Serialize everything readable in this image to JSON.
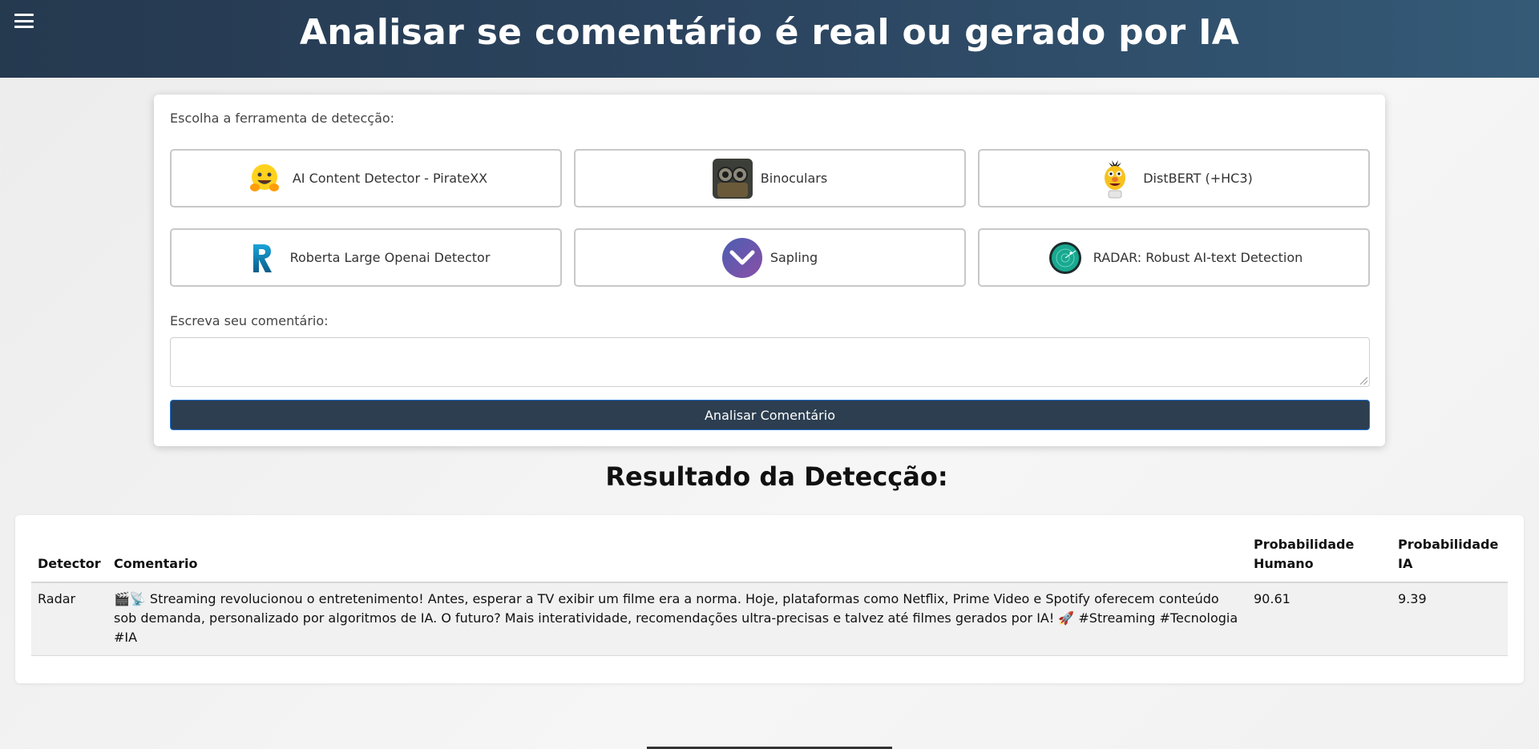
{
  "header": {
    "title": "Analisar se comentário é real ou gerado por IA",
    "menu_icon": "hamburger-menu-icon"
  },
  "form": {
    "tool_label": "Escolha a ferramenta de detecção:",
    "tools": [
      {
        "label": "AI Content Detector - PirateXX",
        "icon": "hugging-face-icon"
      },
      {
        "label": "Binoculars",
        "icon": "binoculars-robot-icon"
      },
      {
        "label": "DistBERT (+HC3)",
        "icon": "bert-muppet-icon"
      },
      {
        "label": "Roberta Large Openai Detector",
        "icon": "roberta-r-icon"
      },
      {
        "label": "Sapling",
        "icon": "sapling-chevron-icon"
      },
      {
        "label": "RADAR: Robust AI-text Detection",
        "icon": "radar-icon"
      }
    ],
    "comment_label": "Escreva seu comentário:",
    "comment_value": "",
    "submit_label": "Analisar Comentário"
  },
  "results": {
    "title": "Resultado da Detecção:",
    "columns": [
      "Detector",
      "Comentario",
      "Probabilidade Humano",
      "Probabilidade IA"
    ],
    "rows": [
      {
        "detector": "Radar",
        "comment": "🎬📡 Streaming revolucionou o entretenimento! Antes, esperar a TV exibir um filme era a norma. Hoje, plataformas como Netflix, Prime Video e Spotify oferecem conteúdo sob demanda, personalizado por algoritmos de IA. O futuro? Mais interatividade, recomendações ultra-precisas e talvez até filmes gerados por IA! 🚀 #Streaming #Tecnologia #IA",
        "human": "90.61",
        "ai": "9.39"
      }
    ]
  },
  "colors": {
    "header_start": "#25394f",
    "header_end": "#345a77",
    "button_bg": "#2c3e50",
    "button_border": "#1e6fd0"
  }
}
